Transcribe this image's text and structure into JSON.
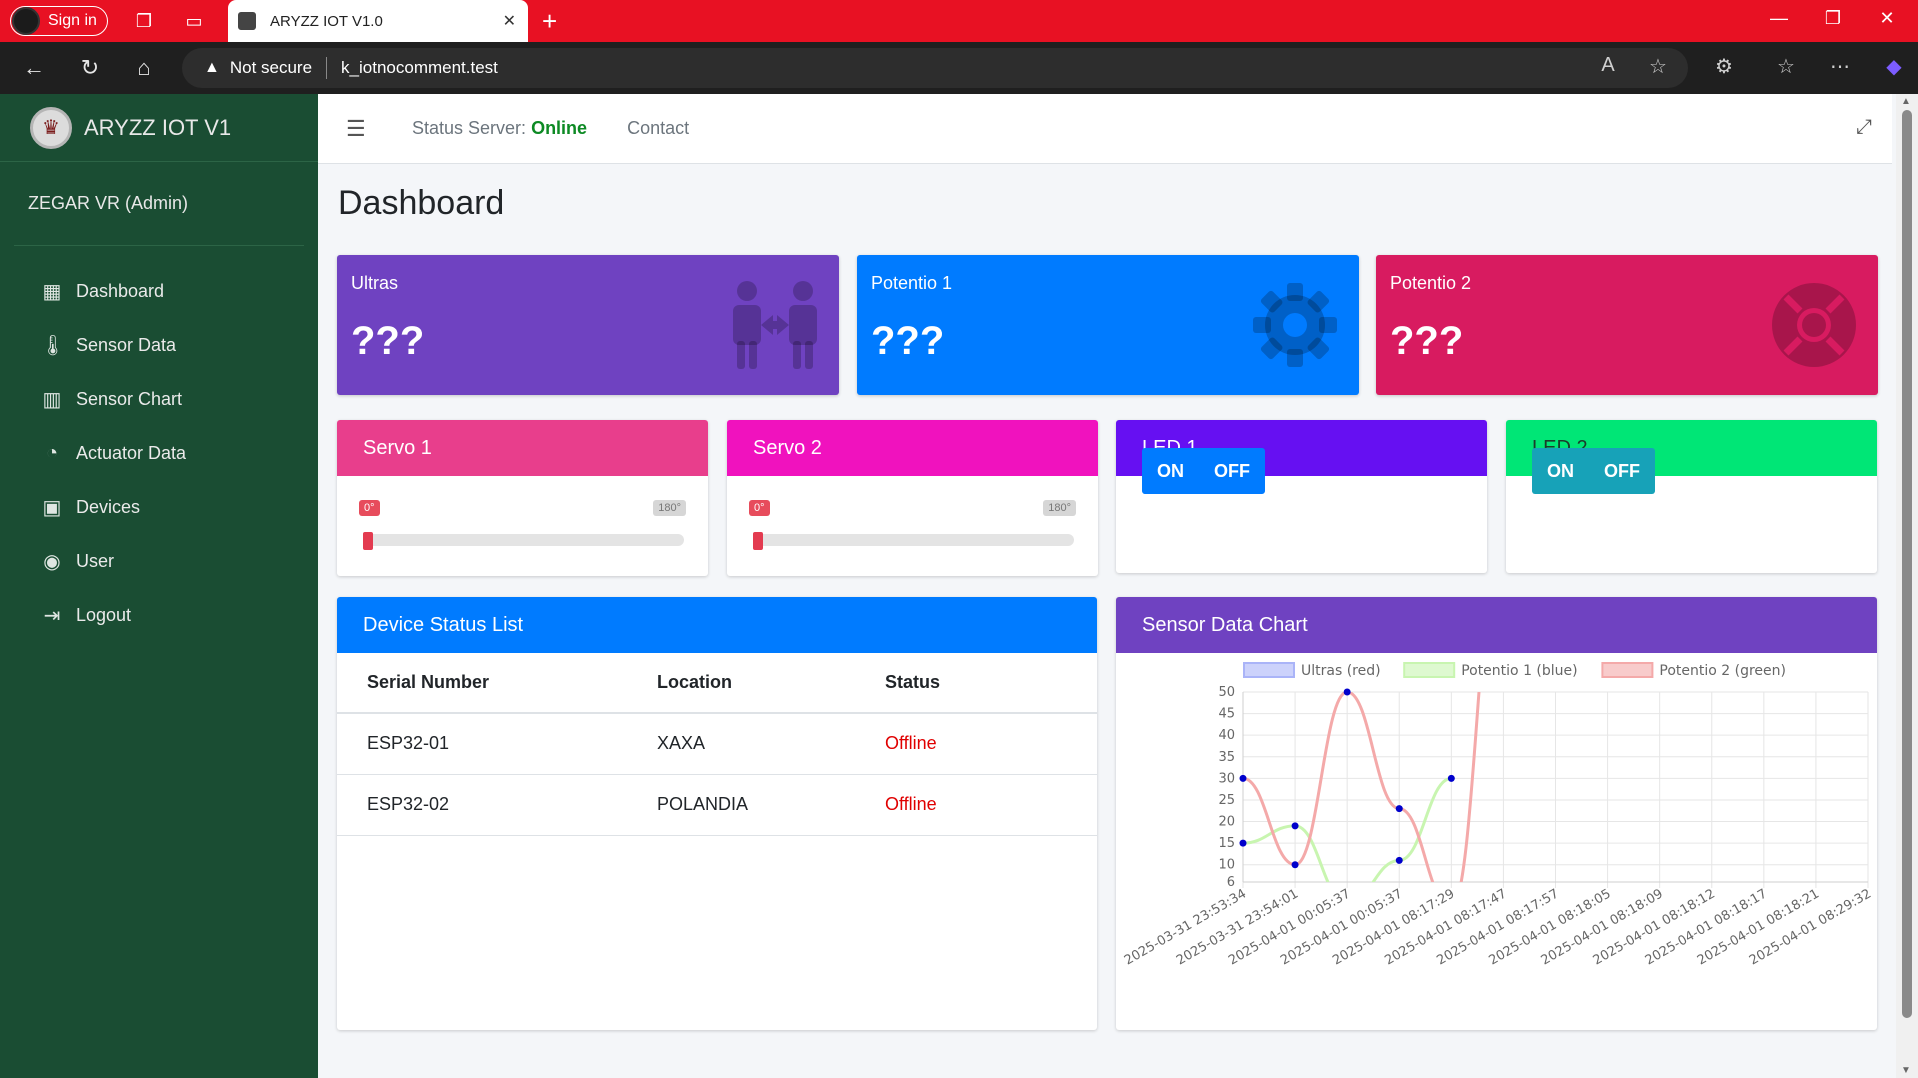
{
  "browser": {
    "signin_label": "Sign in",
    "tab_title": "ARYZZ IOT V1.0",
    "not_secure": "Not secure",
    "url": "k_iotnocomment.test"
  },
  "sidebar": {
    "brand": "ARYZZ IOT V1",
    "user": "ZEGAR VR (Admin)",
    "items": [
      {
        "label": "Dashboard",
        "icon": "dashboard-icon"
      },
      {
        "label": "Sensor Data",
        "icon": "thermometer-icon"
      },
      {
        "label": "Sensor Chart",
        "icon": "bar-chart-icon"
      },
      {
        "label": "Actuator Data",
        "icon": "gauge-icon"
      },
      {
        "label": "Devices",
        "icon": "chip-icon"
      },
      {
        "label": "User",
        "icon": "user-circle-icon"
      },
      {
        "label": "Logout",
        "icon": "logout-icon"
      }
    ]
  },
  "header": {
    "status_label": "Status Server:",
    "status_value": "Online",
    "contact": "Contact"
  },
  "page": {
    "title": "Dashboard"
  },
  "info_boxes": [
    {
      "label": "Ultras",
      "value": "???",
      "color": "#6f42c1",
      "icon": "people-distance-icon"
    },
    {
      "label": "Potentio 1",
      "value": "???",
      "color": "#007bff",
      "icon": "gear-icon"
    },
    {
      "label": "Potentio 2",
      "value": "???",
      "color": "#d81b60",
      "icon": "life-ring-icon"
    }
  ],
  "servos": [
    {
      "title": "Servo 1",
      "min_label": "0°",
      "max_label": "180°",
      "value": 0,
      "color": "#e83e8c"
    },
    {
      "title": "Servo 2",
      "min_label": "0°",
      "max_label": "180°",
      "value": 0,
      "color": "#f012be"
    }
  ],
  "leds": [
    {
      "title": "LED 1",
      "on": "ON",
      "off": "OFF",
      "color": "#6610f2",
      "button_color": "#007bff"
    },
    {
      "title": "LED 2",
      "on": "ON",
      "off": "OFF",
      "color": "#00e676",
      "button_color": "#17a2b8"
    }
  ],
  "device_table": {
    "title": "Device Status List",
    "columns": [
      "Serial Number",
      "Location",
      "Status"
    ],
    "rows": [
      [
        "ESP32-01",
        "XAXA",
        "Offline"
      ],
      [
        "ESP32-02",
        "POLANDIA",
        "Offline"
      ]
    ]
  },
  "chart_data": {
    "type": "line",
    "title": "Sensor Data Chart",
    "x": [
      "2025-03-31 23:53:34",
      "2025-03-31 23:54:01",
      "2025-04-01 00:05:37",
      "2025-04-01 00:05:37",
      "2025-04-01 08:17:29",
      "2025-04-01 08:17:47",
      "2025-04-01 08:17:57",
      "2025-04-01 08:18:05",
      "2025-04-01 08:18:09",
      "2025-04-01 08:18:12",
      "2025-04-01 08:18:17",
      "2025-04-01 08:18:21",
      "2025-04-01 08:29:32"
    ],
    "y_ticks": [
      6,
      10,
      15,
      20,
      25,
      30,
      35,
      40,
      45,
      50
    ],
    "ylim": [
      6,
      50
    ],
    "series": [
      {
        "name": "Ultras (red)",
        "color": "#aab4f8",
        "values": [
          null,
          null,
          null,
          null,
          null,
          null,
          null,
          null,
          null,
          null,
          null,
          null,
          null
        ]
      },
      {
        "name": "Potentio 1 (blue)",
        "color": "#c8f5b0",
        "values": [
          15,
          19,
          1,
          11,
          30,
          null,
          null,
          null,
          null,
          null,
          null,
          null,
          null
        ]
      },
      {
        "name": "Potentio 2 (green)",
        "color": "#f4a9a9",
        "values": [
          30,
          10,
          50,
          23,
          0,
          90,
          null,
          null,
          null,
          null,
          null,
          null,
          null
        ]
      }
    ],
    "grid": true,
    "legend": "top"
  }
}
